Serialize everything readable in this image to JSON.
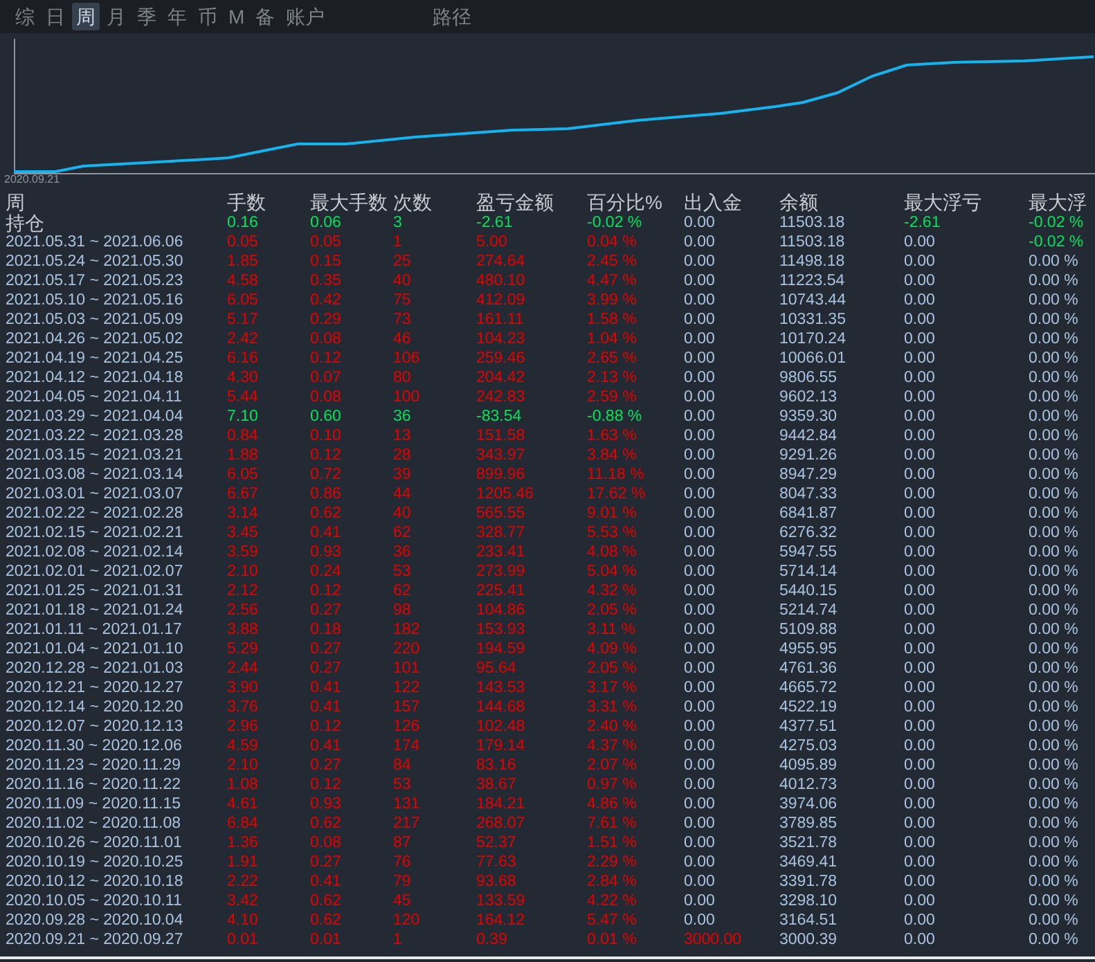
{
  "tabs": [
    {
      "label": "综",
      "selected": false
    },
    {
      "label": "日",
      "selected": false
    },
    {
      "label": "周",
      "selected": true
    },
    {
      "label": "月",
      "selected": false
    },
    {
      "label": "季",
      "selected": false
    },
    {
      "label": "年",
      "selected": false
    },
    {
      "label": "币",
      "selected": false
    },
    {
      "label": "M",
      "selected": false
    },
    {
      "label": "备",
      "selected": false
    },
    {
      "label": "账户",
      "selected": false
    }
  ],
  "path_tab": {
    "label": "路径"
  },
  "chart": {
    "start_label": "2020.09.21"
  },
  "table": {
    "columns": [
      "周",
      "手数",
      "最大手数",
      "次数",
      "盈亏金额",
      "百分比%",
      "出入金",
      "余额",
      "最大浮亏",
      "最大浮"
    ],
    "rows": [
      {
        "cells": [
          "持仓",
          "0.16",
          "0.06",
          "3",
          "-2.61",
          "-0.02 %",
          "0.00",
          "11503.18",
          "-2.61",
          "-0.02 %"
        ],
        "loss": true,
        "deposit_in": false,
        "drawdown_loss": true,
        "drawdown_pct_loss": true
      },
      {
        "cells": [
          "2021.05.31 ~ 2021.06.06",
          "0.05",
          "0.05",
          "1",
          "5.00",
          "0.04 %",
          "0.00",
          "11503.18",
          "0.00",
          "-0.02 %"
        ],
        "loss": false,
        "deposit_in": false,
        "drawdown_loss": false,
        "drawdown_pct_loss": true
      },
      {
        "cells": [
          "2021.05.24 ~ 2021.05.30",
          "1.85",
          "0.15",
          "25",
          "274.64",
          "2.45 %",
          "0.00",
          "11498.18",
          "0.00",
          "0.00 %"
        ],
        "loss": false,
        "deposit_in": false,
        "drawdown_loss": false,
        "drawdown_pct_loss": false
      },
      {
        "cells": [
          "2021.05.17 ~ 2021.05.23",
          "4.58",
          "0.35",
          "40",
          "480.10",
          "4.47 %",
          "0.00",
          "11223.54",
          "0.00",
          "0.00 %"
        ],
        "loss": false,
        "deposit_in": false,
        "drawdown_loss": false,
        "drawdown_pct_loss": false
      },
      {
        "cells": [
          "2021.05.10 ~ 2021.05.16",
          "6.05",
          "0.42",
          "75",
          "412.09",
          "3.99 %",
          "0.00",
          "10743.44",
          "0.00",
          "0.00 %"
        ],
        "loss": false,
        "deposit_in": false,
        "drawdown_loss": false,
        "drawdown_pct_loss": false
      },
      {
        "cells": [
          "2021.05.03 ~ 2021.05.09",
          "5.17",
          "0.29",
          "73",
          "161.11",
          "1.58 %",
          "0.00",
          "10331.35",
          "0.00",
          "0.00 %"
        ],
        "loss": false,
        "deposit_in": false,
        "drawdown_loss": false,
        "drawdown_pct_loss": false
      },
      {
        "cells": [
          "2021.04.26 ~ 2021.05.02",
          "2.42",
          "0.08",
          "46",
          "104.23",
          "1.04 %",
          "0.00",
          "10170.24",
          "0.00",
          "0.00 %"
        ],
        "loss": false,
        "deposit_in": false,
        "drawdown_loss": false,
        "drawdown_pct_loss": false
      },
      {
        "cells": [
          "2021.04.19 ~ 2021.04.25",
          "6.16",
          "0.12",
          "106",
          "259.46",
          "2.65 %",
          "0.00",
          "10066.01",
          "0.00",
          "0.00 %"
        ],
        "loss": false,
        "deposit_in": false,
        "drawdown_loss": false,
        "drawdown_pct_loss": false
      },
      {
        "cells": [
          "2021.04.12 ~ 2021.04.18",
          "4.30",
          "0.07",
          "80",
          "204.42",
          "2.13 %",
          "0.00",
          "9806.55",
          "0.00",
          "0.00 %"
        ],
        "loss": false,
        "deposit_in": false,
        "drawdown_loss": false,
        "drawdown_pct_loss": false
      },
      {
        "cells": [
          "2021.04.05 ~ 2021.04.11",
          "5.44",
          "0.08",
          "100",
          "242.83",
          "2.59 %",
          "0.00",
          "9602.13",
          "0.00",
          "0.00 %"
        ],
        "loss": false,
        "deposit_in": false,
        "drawdown_loss": false,
        "drawdown_pct_loss": false
      },
      {
        "cells": [
          "2021.03.29 ~ 2021.04.04",
          "7.10",
          "0.60",
          "36",
          "-83.54",
          "-0.88 %",
          "0.00",
          "9359.30",
          "0.00",
          "0.00 %"
        ],
        "loss": true,
        "deposit_in": false,
        "drawdown_loss": false,
        "drawdown_pct_loss": false
      },
      {
        "cells": [
          "2021.03.22 ~ 2021.03.28",
          "0.84",
          "0.10",
          "13",
          "151.58",
          "1.63 %",
          "0.00",
          "9442.84",
          "0.00",
          "0.00 %"
        ],
        "loss": false,
        "deposit_in": false,
        "drawdown_loss": false,
        "drawdown_pct_loss": false
      },
      {
        "cells": [
          "2021.03.15 ~ 2021.03.21",
          "1.88",
          "0.12",
          "28",
          "343.97",
          "3.84 %",
          "0.00",
          "9291.26",
          "0.00",
          "0.00 %"
        ],
        "loss": false,
        "deposit_in": false,
        "drawdown_loss": false,
        "drawdown_pct_loss": false
      },
      {
        "cells": [
          "2021.03.08 ~ 2021.03.14",
          "6.05",
          "0.72",
          "39",
          "899.96",
          "11.18 %",
          "0.00",
          "8947.29",
          "0.00",
          "0.00 %"
        ],
        "loss": false,
        "deposit_in": false,
        "drawdown_loss": false,
        "drawdown_pct_loss": false
      },
      {
        "cells": [
          "2021.03.01 ~ 2021.03.07",
          "6.67",
          "0.86",
          "44",
          "1205.46",
          "17.62 %",
          "0.00",
          "8047.33",
          "0.00",
          "0.00 %"
        ],
        "loss": false,
        "deposit_in": false,
        "drawdown_loss": false,
        "drawdown_pct_loss": false
      },
      {
        "cells": [
          "2021.02.22 ~ 2021.02.28",
          "3.14",
          "0.62",
          "40",
          "565.55",
          "9.01 %",
          "0.00",
          "6841.87",
          "0.00",
          "0.00 %"
        ],
        "loss": false,
        "deposit_in": false,
        "drawdown_loss": false,
        "drawdown_pct_loss": false
      },
      {
        "cells": [
          "2021.02.15 ~ 2021.02.21",
          "3.45",
          "0.41",
          "62",
          "328.77",
          "5.53 %",
          "0.00",
          "6276.32",
          "0.00",
          "0.00 %"
        ],
        "loss": false,
        "deposit_in": false,
        "drawdown_loss": false,
        "drawdown_pct_loss": false
      },
      {
        "cells": [
          "2021.02.08 ~ 2021.02.14",
          "3.59",
          "0.93",
          "36",
          "233.41",
          "4.08 %",
          "0.00",
          "5947.55",
          "0.00",
          "0.00 %"
        ],
        "loss": false,
        "deposit_in": false,
        "drawdown_loss": false,
        "drawdown_pct_loss": false
      },
      {
        "cells": [
          "2021.02.01 ~ 2021.02.07",
          "2.10",
          "0.24",
          "53",
          "273.99",
          "5.04 %",
          "0.00",
          "5714.14",
          "0.00",
          "0.00 %"
        ],
        "loss": false,
        "deposit_in": false,
        "drawdown_loss": false,
        "drawdown_pct_loss": false
      },
      {
        "cells": [
          "2021.01.25 ~ 2021.01.31",
          "2.12",
          "0.12",
          "62",
          "225.41",
          "4.32 %",
          "0.00",
          "5440.15",
          "0.00",
          "0.00 %"
        ],
        "loss": false,
        "deposit_in": false,
        "drawdown_loss": false,
        "drawdown_pct_loss": false
      },
      {
        "cells": [
          "2021.01.18 ~ 2021.01.24",
          "2.56",
          "0.27",
          "98",
          "104.86",
          "2.05 %",
          "0.00",
          "5214.74",
          "0.00",
          "0.00 %"
        ],
        "loss": false,
        "deposit_in": false,
        "drawdown_loss": false,
        "drawdown_pct_loss": false
      },
      {
        "cells": [
          "2021.01.11 ~ 2021.01.17",
          "3.88",
          "0.18",
          "182",
          "153.93",
          "3.11 %",
          "0.00",
          "5109.88",
          "0.00",
          "0.00 %"
        ],
        "loss": false,
        "deposit_in": false,
        "drawdown_loss": false,
        "drawdown_pct_loss": false
      },
      {
        "cells": [
          "2021.01.04 ~ 2021.01.10",
          "5.29",
          "0.27",
          "220",
          "194.59",
          "4.09 %",
          "0.00",
          "4955.95",
          "0.00",
          "0.00 %"
        ],
        "loss": false,
        "deposit_in": false,
        "drawdown_loss": false,
        "drawdown_pct_loss": false
      },
      {
        "cells": [
          "2020.12.28 ~ 2021.01.03",
          "2.44",
          "0.27",
          "101",
          "95.64",
          "2.05 %",
          "0.00",
          "4761.36",
          "0.00",
          "0.00 %"
        ],
        "loss": false,
        "deposit_in": false,
        "drawdown_loss": false,
        "drawdown_pct_loss": false
      },
      {
        "cells": [
          "2020.12.21 ~ 2020.12.27",
          "3.90",
          "0.41",
          "122",
          "143.53",
          "3.17 %",
          "0.00",
          "4665.72",
          "0.00",
          "0.00 %"
        ],
        "loss": false,
        "deposit_in": false,
        "drawdown_loss": false,
        "drawdown_pct_loss": false
      },
      {
        "cells": [
          "2020.12.14 ~ 2020.12.20",
          "3.76",
          "0.41",
          "157",
          "144.68",
          "3.31 %",
          "0.00",
          "4522.19",
          "0.00",
          "0.00 %"
        ],
        "loss": false,
        "deposit_in": false,
        "drawdown_loss": false,
        "drawdown_pct_loss": false
      },
      {
        "cells": [
          "2020.12.07 ~ 2020.12.13",
          "2.96",
          "0.12",
          "126",
          "102.48",
          "2.40 %",
          "0.00",
          "4377.51",
          "0.00",
          "0.00 %"
        ],
        "loss": false,
        "deposit_in": false,
        "drawdown_loss": false,
        "drawdown_pct_loss": false
      },
      {
        "cells": [
          "2020.11.30 ~ 2020.12.06",
          "4.59",
          "0.41",
          "174",
          "179.14",
          "4.37 %",
          "0.00",
          "4275.03",
          "0.00",
          "0.00 %"
        ],
        "loss": false,
        "deposit_in": false,
        "drawdown_loss": false,
        "drawdown_pct_loss": false
      },
      {
        "cells": [
          "2020.11.23 ~ 2020.11.29",
          "2.10",
          "0.27",
          "84",
          "83.16",
          "2.07 %",
          "0.00",
          "4095.89",
          "0.00",
          "0.00 %"
        ],
        "loss": false,
        "deposit_in": false,
        "drawdown_loss": false,
        "drawdown_pct_loss": false
      },
      {
        "cells": [
          "2020.11.16 ~ 2020.11.22",
          "1.08",
          "0.12",
          "53",
          "38.67",
          "0.97 %",
          "0.00",
          "4012.73",
          "0.00",
          "0.00 %"
        ],
        "loss": false,
        "deposit_in": false,
        "drawdown_loss": false,
        "drawdown_pct_loss": false
      },
      {
        "cells": [
          "2020.11.09 ~ 2020.11.15",
          "4.61",
          "0.93",
          "131",
          "184.21",
          "4.86 %",
          "0.00",
          "3974.06",
          "0.00",
          "0.00 %"
        ],
        "loss": false,
        "deposit_in": false,
        "drawdown_loss": false,
        "drawdown_pct_loss": false
      },
      {
        "cells": [
          "2020.11.02 ~ 2020.11.08",
          "6.84",
          "0.62",
          "217",
          "268.07",
          "7.61 %",
          "0.00",
          "3789.85",
          "0.00",
          "0.00 %"
        ],
        "loss": false,
        "deposit_in": false,
        "drawdown_loss": false,
        "drawdown_pct_loss": false
      },
      {
        "cells": [
          "2020.10.26 ~ 2020.11.01",
          "1.36",
          "0.08",
          "87",
          "52.37",
          "1.51 %",
          "0.00",
          "3521.78",
          "0.00",
          "0.00 %"
        ],
        "loss": false,
        "deposit_in": false,
        "drawdown_loss": false,
        "drawdown_pct_loss": false
      },
      {
        "cells": [
          "2020.10.19 ~ 2020.10.25",
          "1.91",
          "0.27",
          "76",
          "77.63",
          "2.29 %",
          "0.00",
          "3469.41",
          "0.00",
          "0.00 %"
        ],
        "loss": false,
        "deposit_in": false,
        "drawdown_loss": false,
        "drawdown_pct_loss": false
      },
      {
        "cells": [
          "2020.10.12 ~ 2020.10.18",
          "2.22",
          "0.41",
          "79",
          "93.68",
          "2.84 %",
          "0.00",
          "3391.78",
          "0.00",
          "0.00 %"
        ],
        "loss": false,
        "deposit_in": false,
        "drawdown_loss": false,
        "drawdown_pct_loss": false
      },
      {
        "cells": [
          "2020.10.05 ~ 2020.10.11",
          "3.42",
          "0.62",
          "45",
          "133.59",
          "4.22 %",
          "0.00",
          "3298.10",
          "0.00",
          "0.00 %"
        ],
        "loss": false,
        "deposit_in": false,
        "drawdown_loss": false,
        "drawdown_pct_loss": false
      },
      {
        "cells": [
          "2020.09.28 ~ 2020.10.04",
          "4.10",
          "0.62",
          "120",
          "164.12",
          "5.47 %",
          "0.00",
          "3164.51",
          "0.00",
          "0.00 %"
        ],
        "loss": false,
        "deposit_in": false,
        "drawdown_loss": false,
        "drawdown_pct_loss": false
      },
      {
        "cells": [
          "2020.09.21 ~ 2020.09.27",
          "0.01",
          "0.01",
          "1",
          "0.39",
          "0.01 %",
          "3000.00",
          "3000.39",
          "0.00",
          "0.00 %"
        ],
        "loss": false,
        "deposit_in": true,
        "drawdown_loss": false,
        "drawdown_pct_loss": false
      }
    ]
  }
}
